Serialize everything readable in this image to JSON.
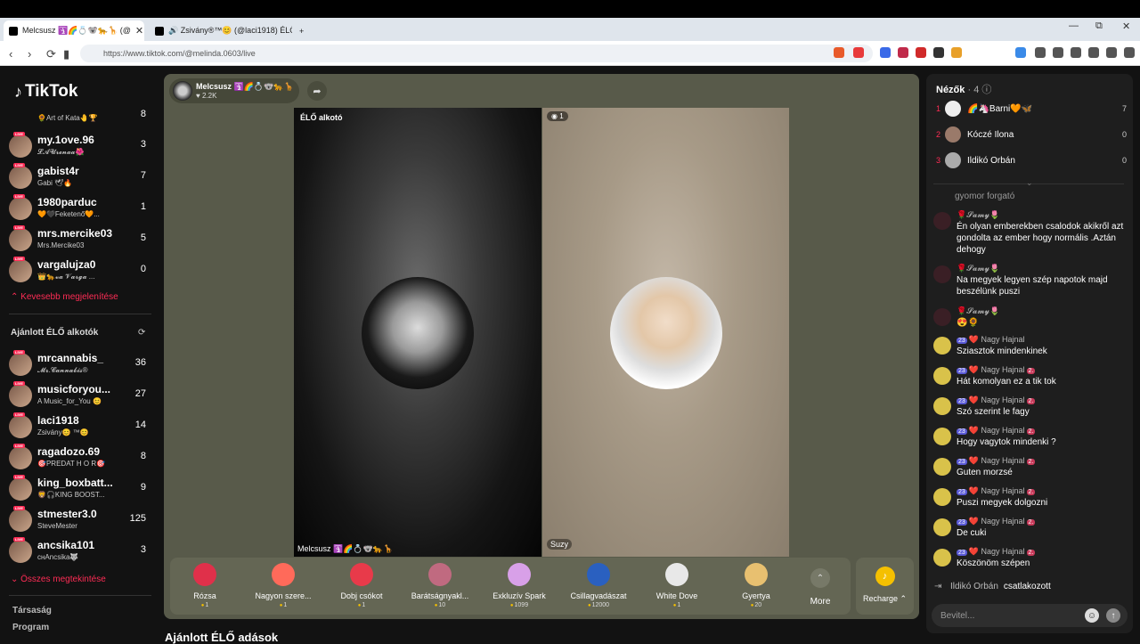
{
  "browser": {
    "tabs": [
      {
        "title": "Melcsusz 🛐🌈💍🐨🐆🦒 (@"
      },
      {
        "title": "🔊 Zsivány®™😊 (@laci1918) ÉLŐ a"
      }
    ],
    "new_tab": "+",
    "url": "https://www.tiktok.com/@melinda.0603/live"
  },
  "sidebar": {
    "logo": "TikTok",
    "following": [
      {
        "name": "",
        "sub": "🌻Art of Kata🤚🏆",
        "count": "8"
      },
      {
        "name": "my.1ove.96",
        "sub": "𝓛𝓐𝓤𝓻𝓮𝓷𝓪𝓪🌺",
        "count": "3"
      },
      {
        "name": "gabist4r",
        "sub": "Gabi 🕊🔥",
        "count": "7"
      },
      {
        "name": "1980parduc",
        "sub": "🧡🖤Feketenő🧡...",
        "count": "1"
      },
      {
        "name": "mrs.mercike03",
        "sub": "Mrs.Mercike03",
        "count": "5"
      },
      {
        "name": "vargalujza0",
        "sub": "👑🐆𝓿𝓪 𝓥𝓪𝓻𝓰𝓪 ...",
        "count": "0"
      }
    ],
    "show_less": "⌃ Kevesebb megjelenítése",
    "recommended_title": "Ajánlott ÉLŐ alkotók",
    "recommended": [
      {
        "name": "mrcannabis_",
        "sub": "𝓜𝓻.𝓒𝓪𝓷𝓷𝓪𝓫𝓲𝓼®",
        "count": "36"
      },
      {
        "name": "musicforyou...",
        "sub": "A Music_for_You 😊",
        "count": "27"
      },
      {
        "name": "laci1918",
        "sub": "Zsivány😊 ™😊",
        "count": "14"
      },
      {
        "name": "ragadozo.69",
        "sub": "🎯PREDAT H O R🎯",
        "count": "8"
      },
      {
        "name": "king_boxbatt...",
        "sub": "🦁🎧KING BOOST...",
        "count": "9"
      },
      {
        "name": "stmester3.0",
        "sub": "SteveMester",
        "count": "125"
      },
      {
        "name": "ancsika101",
        "sub": "снAncsika🐺",
        "count": "3"
      }
    ],
    "show_all": "⌄ Összes megtekintése",
    "footer": [
      "Társaság",
      "Program"
    ]
  },
  "stream": {
    "host_name": "Melcsusz 🛐🌈💍🐨🐆🦒",
    "likes": "♥ 2.2K",
    "left_label": "ÉLŐ alkotó",
    "left_bottom": "Melcsusz 🛐🌈💍🐨🐆🦒",
    "right_count": "◉ 1",
    "right_bottom": "Suzy"
  },
  "gifts": [
    {
      "name": "Rózsa",
      "price": "1",
      "color": "#e0304a"
    },
    {
      "name": "Nagyon szere...",
      "price": "1",
      "color": "#ff6a5a"
    },
    {
      "name": "Dobj csókot",
      "price": "1",
      "color": "#e83a4a"
    },
    {
      "name": "Barátságnyakl...",
      "price": "10",
      "color": "#c06a80"
    },
    {
      "name": "Exkluzív Spark",
      "price": "1099",
      "color": "#d8a0e8"
    },
    {
      "name": "Csillagvadászat",
      "price": "12000",
      "color": "#2a60c0"
    },
    {
      "name": "White Dove",
      "price": "1",
      "color": "#e8e8e8"
    },
    {
      "name": "Gyertya",
      "price": "20",
      "color": "#e8c070"
    }
  ],
  "more_label": "More",
  "recharge_label": "Recharge ⌃",
  "recommended_section_title": "Ajánlott ÉLŐ adások",
  "viewers": {
    "title": "Nézők",
    "count": "· 4",
    "list": [
      {
        "rank": "1",
        "name": "🌈🦄Barni🧡🦋",
        "score": "7"
      },
      {
        "rank": "2",
        "name": "Kóczé Ilona",
        "score": "0"
      },
      {
        "rank": "3",
        "name": "Ildikó Orbán",
        "score": "0"
      }
    ]
  },
  "chat": {
    "cut_text": "gyomor forgató",
    "messages": [
      {
        "user": "🌹𝓢𝓪𝓶𝔂🌷",
        "text": "Én olyan emberekben csalodok akikről azt gondolta az ember hogy normális .Aztán dehogy",
        "type": "samy"
      },
      {
        "user": "🌹𝓢𝓪𝓶𝔂🌷",
        "text": "Na megyek legyen szép napotok majd beszélünk puszi",
        "type": "samy"
      },
      {
        "user": "🌹𝓢𝓪𝓶𝔂🌷",
        "text": "😍🌻",
        "type": "samy"
      },
      {
        "user": "Nagy Hajnal",
        "text": "Sziasztok mindenkinek",
        "type": "hajnal",
        "badge": "23",
        "badge2": ""
      },
      {
        "user": "Nagy Hajnal",
        "text": "Hát komolyan ez a tik tok",
        "type": "hajnal",
        "badge": "23",
        "badge2": "2."
      },
      {
        "user": "Nagy Hajnal",
        "text": "Szó szerint le fagy",
        "type": "hajnal",
        "badge": "23",
        "badge2": "2."
      },
      {
        "user": "Nagy Hajnal",
        "text": "Hogy vagytok mindenki ?",
        "type": "hajnal",
        "badge": "23",
        "badge2": "2."
      },
      {
        "user": "Nagy Hajnal",
        "text": "Guten morzsé",
        "type": "hajnal",
        "badge": "23",
        "badge2": "2."
      },
      {
        "user": "Nagy Hajnal",
        "text": "Puszi megyek dolgozni",
        "type": "hajnal",
        "badge": "23",
        "badge2": "2."
      },
      {
        "user": "Nagy Hajnal",
        "text": "De cuki",
        "type": "hajnal",
        "badge": "23",
        "badge2": "2."
      },
      {
        "user": "Nagy Hajnal",
        "text": "Köszönöm szépen",
        "type": "hajnal",
        "badge": "23",
        "badge2": "2."
      }
    ],
    "joined_name": "Ildikó Orbán",
    "joined_text": "csatlakozott",
    "input_placeholder": "Bevitel..."
  }
}
